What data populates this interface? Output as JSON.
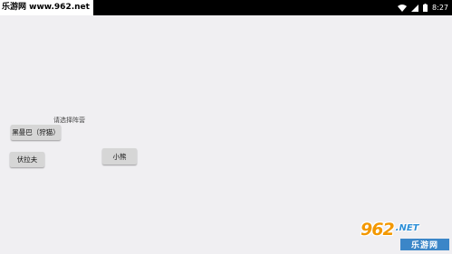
{
  "status_bar": {
    "site_label": "乐游网 www.962.net",
    "time": "8:27",
    "icons": [
      "wifi-icon",
      "signal-icon",
      "battery-icon"
    ]
  },
  "main": {
    "prompt": "请选择阵营",
    "options": [
      {
        "label": "黑曼巴（狩猫）"
      },
      {
        "label": "伏拉夫"
      },
      {
        "label": "小熊"
      }
    ]
  },
  "watermark": {
    "number": "962",
    "suffix": ".NET",
    "site_name": "乐游网"
  },
  "colors": {
    "background": "#f0eff2",
    "status_bar": "#000000",
    "button": "#d6d6d6",
    "watermark_orange": "#f39800",
    "watermark_blue": "#3b86c8"
  }
}
